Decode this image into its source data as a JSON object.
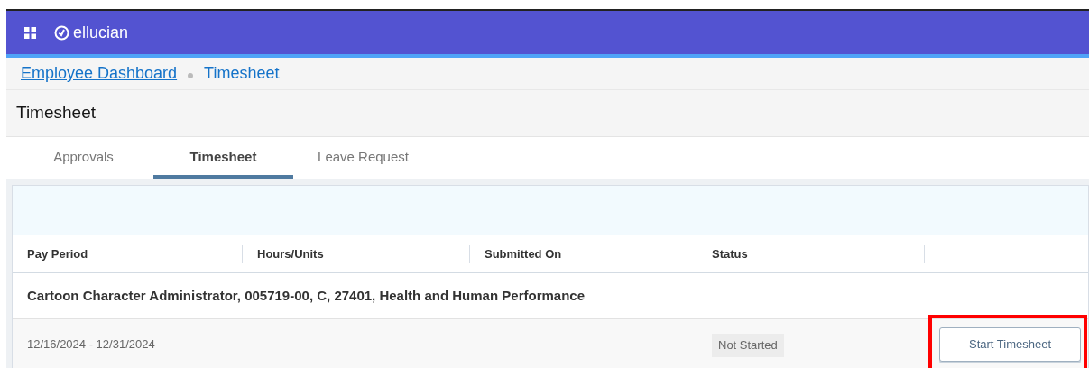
{
  "brand": "ellucian",
  "breadcrumbs": [
    {
      "label": "Employee Dashboard",
      "kind": "link"
    },
    {
      "label": "Timesheet",
      "kind": "current"
    }
  ],
  "page_title": "Timesheet",
  "tabs": [
    {
      "label": "Approvals",
      "selected": false
    },
    {
      "label": "Timesheet",
      "selected": true
    },
    {
      "label": "Leave Request",
      "selected": false
    }
  ],
  "table": {
    "columns": [
      "Pay Period",
      "Hours/Units",
      "Submitted On",
      "Status"
    ],
    "group": "Cartoon Character Administrator, 005719-00, C, 27401, Health and Human Performance",
    "rows": [
      {
        "pay_period": "12/16/2024 - 12/31/2024",
        "status": "Not Started",
        "action": "Start Timesheet",
        "highlighted": true
      }
    ]
  }
}
